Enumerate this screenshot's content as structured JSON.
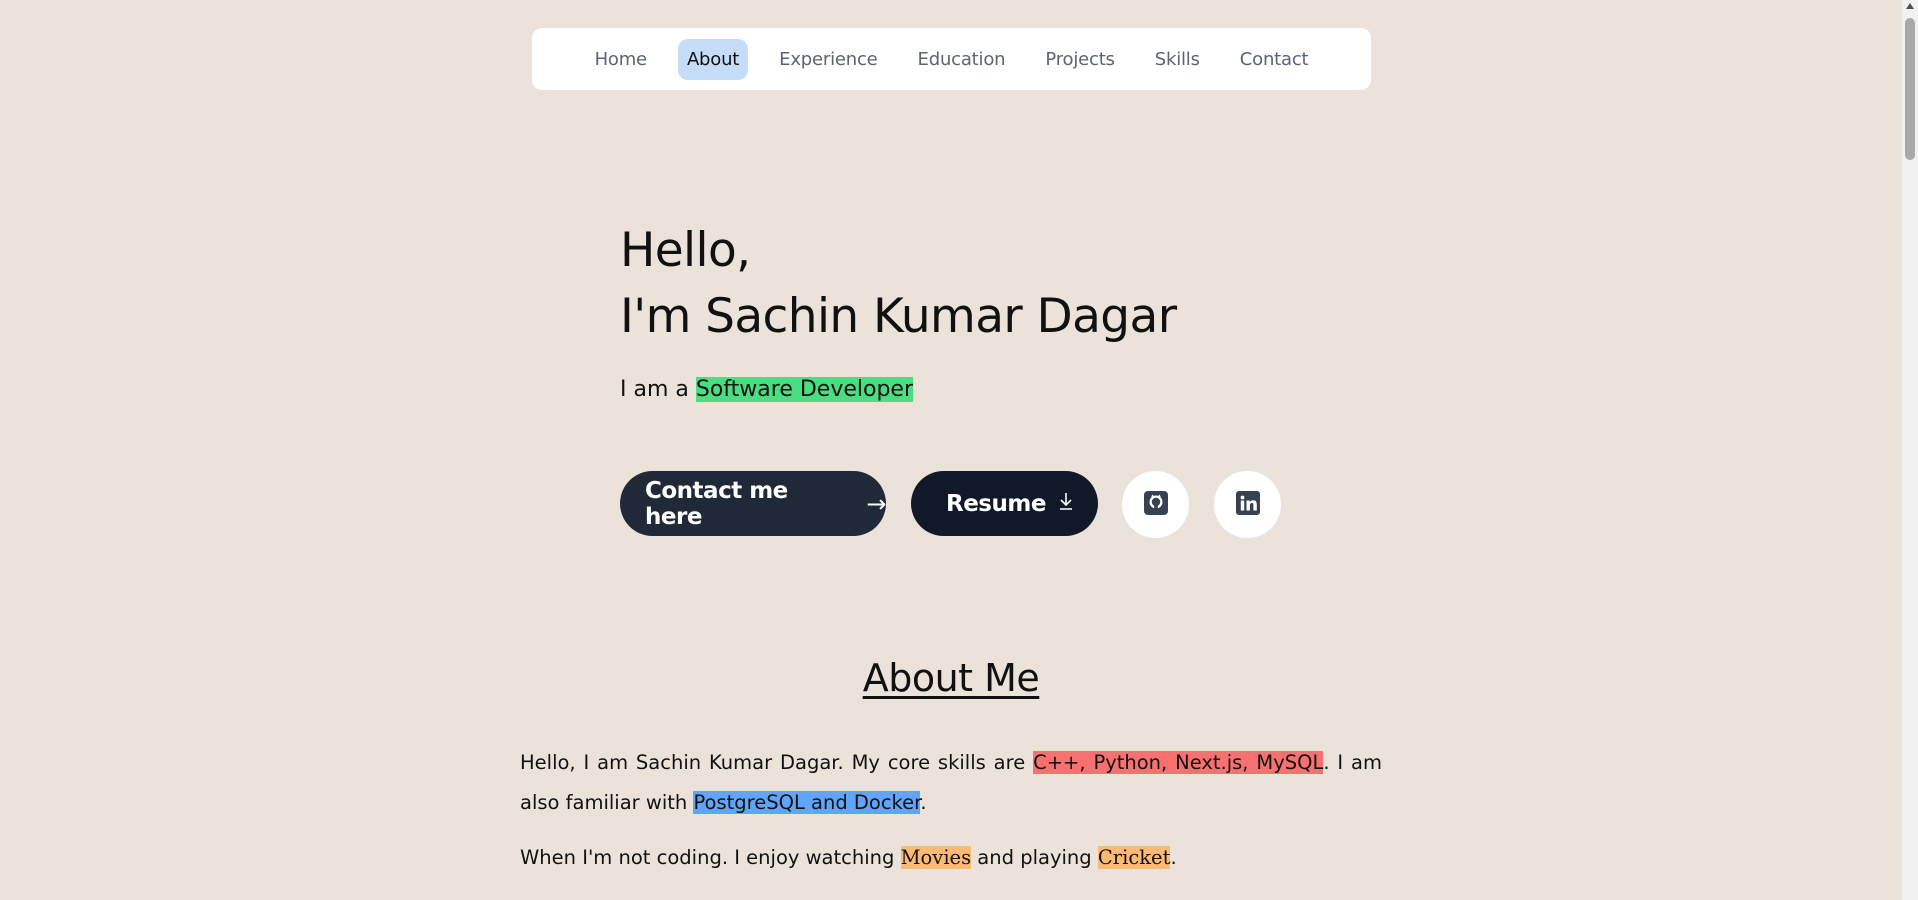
{
  "nav": {
    "items": [
      "Home",
      "About",
      "Experience",
      "Education",
      "Projects",
      "Skills",
      "Contact"
    ],
    "active": "About"
  },
  "hero": {
    "greeting": "Hello,",
    "name": "I'm Sachin Kumar Dagar",
    "role_prefix": "I am a ",
    "role": "Software Developer",
    "contact_button": "Contact me here",
    "resume_button": "Resume",
    "github_icon": "github-icon",
    "linkedin_icon": "linkedin-icon"
  },
  "about": {
    "title": "About Me",
    "p1_before": "Hello, I am Sachin Kumar Dagar. My core skills are ",
    "p1_skills": "C++, Python, Next.js, MySQL",
    "p1_middle": ". I am also familiar with ",
    "p1_familiar": "PostgreSQL and Docker",
    "p1_end": ".",
    "p2_before": "When I'm not coding. I enjoy watching ",
    "p2_hobby1": "Movies",
    "p2_middle": " and playing ",
    "p2_hobby2": "Cricket",
    "p2_end": "."
  },
  "colors": {
    "background": "#ebe3da",
    "active_nav": "#c6ddfa",
    "role_highlight": "#4ade80",
    "skills_highlight": "#f87171",
    "familiar_highlight": "#60a5fa",
    "hobby_highlight": "#fdba74"
  }
}
